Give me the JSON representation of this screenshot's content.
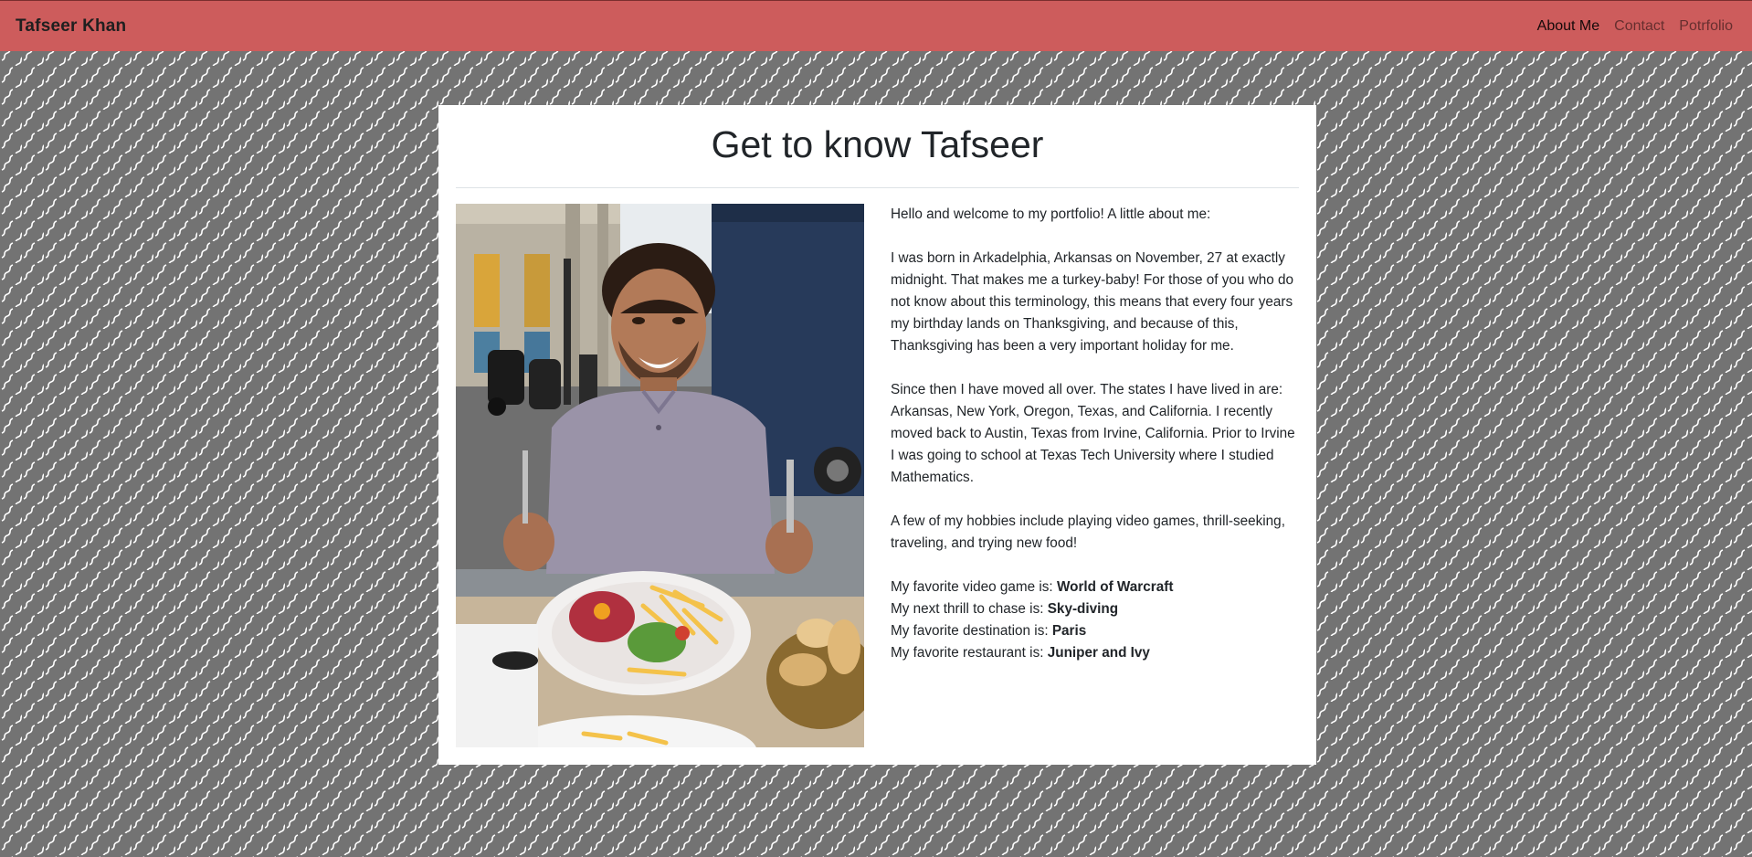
{
  "navbar": {
    "brand": "Tafseer Khan",
    "links": [
      {
        "label": "About Me",
        "active": true
      },
      {
        "label": "Contact",
        "active": false
      },
      {
        "label": "Potrfolio",
        "active": false
      }
    ],
    "color": "#cd5c5c"
  },
  "main": {
    "title": "Get to know Tafseer",
    "intro": "Hello and welcome to my portfolio! A little about me:",
    "paragraph1": "I was born in Arkadelphia, Arkansas on November, 27 at exactly midnight. That makes me a turkey-baby! For those of you who do not know about this terminology, this means that every four years my birthday lands on Thanksgiving, and because of this, Thanksgiving has been a very important holiday for me.",
    "paragraph2": "Since then I have moved all over. The states I have lived in are: Arkansas, New York, Oregon, Texas, and California. I recently moved back to Austin, Texas from Irvine, California. Prior to Irvine I was going to school at Texas Tech University where I studied Mathematics.",
    "paragraph3": "A few of my hobbies include playing video games, thrill-seeking, traveling, and trying new food!",
    "favorites": [
      {
        "label": "My favorite video game is:",
        "value": "World of Warcraft"
      },
      {
        "label": "My next thrill to chase is:",
        "value": "Sky-diving"
      },
      {
        "label": "My favorite destination is:",
        "value": "Paris"
      },
      {
        "label": "My favorite restaurant is:",
        "value": "Juniper and Ivy"
      }
    ]
  }
}
